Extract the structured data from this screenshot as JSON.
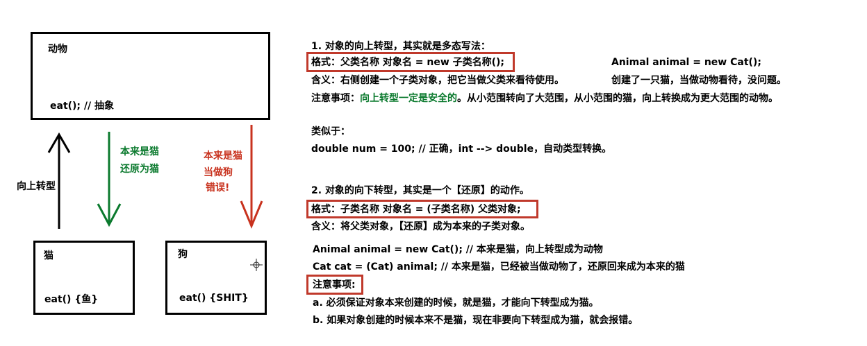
{
  "diagram": {
    "animal_box": {
      "title": "动物",
      "method": "eat(); // 抽象"
    },
    "cat_box": {
      "title": "猫",
      "method": "eat() {鱼}"
    },
    "dog_box": {
      "title": "狗",
      "method": "eat() {SHIT}"
    },
    "upcast_label": "向上转型",
    "green_note": {
      "line1": "本来是猫",
      "line2": "还原为猫"
    },
    "red_note": {
      "line1": "本来是猫",
      "line2": "当做狗",
      "line3": "错误!"
    },
    "colors": {
      "green": "#0b7a2e",
      "red": "#c8321e",
      "highlight": "#c0392b"
    }
  },
  "notes": {
    "s1_title": "1. 对象的向上转型，其实就是多态写法：",
    "s1_format": "格式：父类名称 对象名 = new 子类名称();",
    "s1_example": "Animal animal = new Cat();",
    "s1_meaning": "含义：右侧创建一个子类对象，把它当做父类来看待使用。",
    "s1_example_desc": "创建了一只猫，当做动物看待，没问题。",
    "s1_caution_prefix": "注意事项：",
    "s1_caution_green": "向上转型一定是安全的",
    "s1_caution_rest": "。从小范围转向了大范围，从小范围的猫，向上转换成为更大范围的动物。",
    "similar_label": "类似于：",
    "similar_code": "double num = 100; // 正确，int --> double，自动类型转换。",
    "s2_title": "2. 对象的向下转型，其实是一个【还原】的动作。",
    "s2_format": "格式：子类名称 对象名 = (子类名称) 父类对象;",
    "s2_meaning": "含义：将父类对象，【还原】成为本来的子类对象。",
    "code1": "Animal animal = new Cat(); // 本来是猫，向上转型成为动物",
    "code2": "Cat cat = (Cat) animal; // 本来是猫，已经被当做动物了，还原回来成为本来的猫",
    "caution2": "注意事项:",
    "point_a": "a. 必须保证对象本来创建的时候，就是猫，才能向下转型成为猫。",
    "point_b": "b. 如果对象创建的时候本来不是猫，现在非要向下转型成为猫，就会报错。"
  }
}
